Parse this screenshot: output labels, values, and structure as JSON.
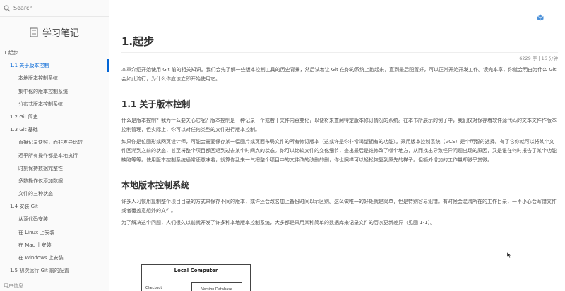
{
  "sidebar": {
    "search_placeholder": "Search",
    "book_title": "学习笔记",
    "toc": [
      {
        "label": "1.起步",
        "level": 1,
        "active": false
      },
      {
        "label": "1.1 关于版本控制",
        "level": 2,
        "active": true
      },
      {
        "label": "本地版本控制系统",
        "level": 3,
        "active": false
      },
      {
        "label": "集中化的版本控制系统",
        "level": 3,
        "active": false
      },
      {
        "label": "分布式版本控制系统",
        "level": 3,
        "active": false
      },
      {
        "label": "1.2 Git 简史",
        "level": 2,
        "active": false
      },
      {
        "label": "1.3 Git 基础",
        "level": 2,
        "active": false
      },
      {
        "label": "直接记录快照，而非差异比较",
        "level": 3,
        "active": false
      },
      {
        "label": "近乎所有操作都是本地执行",
        "level": 3,
        "active": false
      },
      {
        "label": "时刻保持数据完整性",
        "level": 3,
        "active": false
      },
      {
        "label": "多数操作仅添加数据",
        "level": 3,
        "active": false
      },
      {
        "label": "文件的三种状态",
        "level": 3,
        "active": false
      },
      {
        "label": "1.4 安装 Git",
        "level": 2,
        "active": false
      },
      {
        "label": "从源代码安装",
        "level": 3,
        "active": false
      },
      {
        "label": "在 Linux 上安装",
        "level": 3,
        "active": false
      },
      {
        "label": "在 Mac 上安装",
        "level": 3,
        "active": false
      },
      {
        "label": "在 Windows 上安装",
        "level": 3,
        "active": false
      },
      {
        "label": "1.5 初次运行 Git 前的配置",
        "level": 2,
        "active": false
      }
    ],
    "footer_text": "用户信息"
  },
  "main": {
    "title": "1.起步",
    "meta": "6229 字 | 16 分钟",
    "intro": "本章介绍开始使用 Git 前的相关知识。我们会先了解一些版本控制工具的历史背景，然后试着让 Git 在你的系统上跑起来，直到最后配置好，可以正常开始开发工作。读完本章，你就会明白为什么 Git 会如此流行，为什么你应该立即开始使用它。",
    "section1_title": "1.1 关于版本控制",
    "section1_p1": "什么是版本控制？我为什么要关心它呢？版本控制是一种记录一个或若干文件内容变化，以便将来查阅特定版本修订情况的系统。在本书所展示的例子中，我们仅对保存着软件源代码的文本文件作版本控制管理，但实际上，你可以对任何类型的文件进行版本控制。",
    "section1_p2": "如果你是位图形或网页设计师，可能会需要保存某一幅图片或页面布局文件的所有修订版本（这或许是你非常渴望拥有的功能）。采用版本控制系统（VCS）是个明智的选择。有了它你就可以将某个文件回溯到之前的状态，甚至将整个项目都回退到过去某个时间点的状态。你可以比较文件的变化细节，查出最后是谁修改了哪个地方，从而找出导致怪异问题出现的原因，又是谁在何时报告了某个功能缺陷等等。使用版本控制系统通常还意味着，就算你乱来一气把整个项目中的文件改的改删的删，你也照样可以轻松恢复到原先的样子。但额外增加的工作量却微乎其微。",
    "section2_title": "本地版本控制系统",
    "section2_p1": "许多人习惯用复制整个项目目录的方式来保存不同的版本，或许还会改名加上备份时间以示区别。这么做唯一的好处就是简单，但是特别容易犯错。有时候会混淆所在的工作目录，一不小心会写错文件或者覆盖意想外的文件。",
    "section2_p2": "为了解决这个问题，人们很久以前就开发了许多种本地版本控制系统，大多都是采用某种简单的数据库来记录文件的历次更新差异（见图 1-1）。"
  },
  "diagram": {
    "title": "Local Computer",
    "checkout": "Checkout",
    "version_db": "Version Database"
  }
}
